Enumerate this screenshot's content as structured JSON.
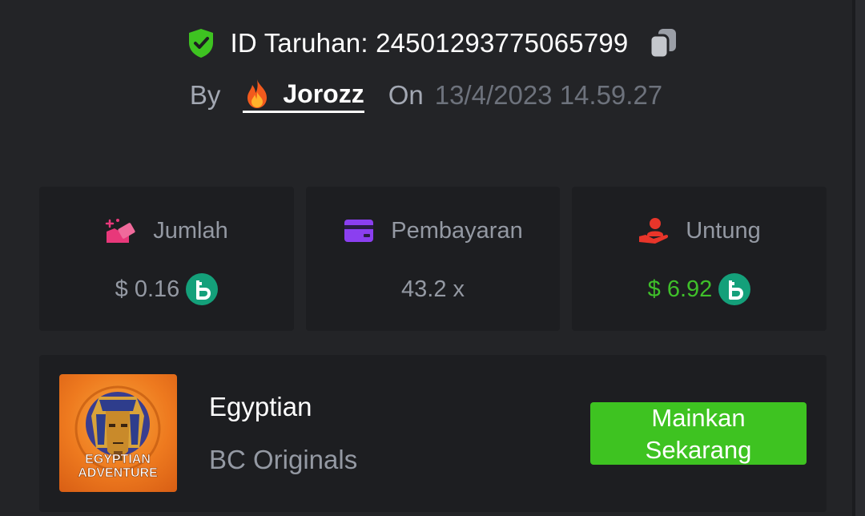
{
  "bet": {
    "id_text": "ID Taruhan: 24501293775065799",
    "by_label": "By",
    "username": "Jorozz",
    "on_label": "On",
    "timestamp": "13/4/2023 14.59.27"
  },
  "stats": [
    {
      "label": "Jumlah",
      "value": "$ 0.16",
      "icon": "hand-money-icon",
      "has_coin": true
    },
    {
      "label": "Pembayaran",
      "value": "43.2 x",
      "icon": "credit-card-icon",
      "has_coin": false
    },
    {
      "label": "Untung",
      "value": "$ 6.92",
      "icon": "hand-person-icon",
      "has_coin": true
    }
  ],
  "game": {
    "title": "Egyptian",
    "provider": "BC Originals",
    "thumbnail_text_line1": "EGYPTIAN",
    "thumbnail_text_line2": "ADVENTURE",
    "play_label_line1": "Mainkan",
    "play_label_line2": "Sekarang"
  },
  "colors": {
    "background": "#232427",
    "card": "#1d1e21",
    "accent_green": "#3ec321",
    "profit_green": "#3fc02a",
    "coin_teal": "#14a07a",
    "muted_text": "#9499a3"
  }
}
